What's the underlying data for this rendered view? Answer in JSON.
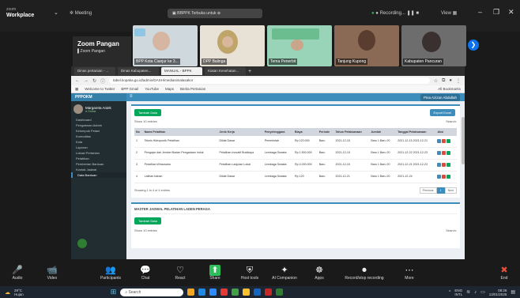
{
  "zoom": {
    "logo_top": "zoom",
    "logo_main": "Workplace",
    "meeting_label": "Meeting",
    "shared_screen_label": "BBPPK Terbuka untuk",
    "recording_label": "Recording...",
    "view_label": "View",
    "self_name": "Zoom Pangan",
    "self_sub": "Zoom Pangan"
  },
  "participants": [
    {
      "name": "BPP Kota Cianjur ke 3..."
    },
    {
      "name": "DPP Balinga"
    },
    {
      "name": "Tema Penerbit"
    },
    {
      "name": "Tanjung Kupong"
    },
    {
      "name": "Kabupaten Pancuran"
    }
  ],
  "browser": {
    "tabs": [
      "Dinas pertanian - ...",
      "Dinas Kabupaten...",
      "MANUAL - BPPK",
      "Kiatan Kesehatan..."
    ],
    "url": "tabel.kopaka.go.id/admin/DASH/mediasimalasakor",
    "bookmarks": [
      "Welcome to Twitter",
      "BPP Gmail",
      "YouTube",
      "Maps",
      "Berita Pertanian"
    ],
    "reading_list": "All Bookmarks"
  },
  "app": {
    "brand": "PPPOKM",
    "user_top": "Pina Azizan Abdullah",
    "side_user_name": "Margareta Aniek",
    "side_user_status": "Online",
    "sidebar": [
      "Dashboard",
      "Pengaturan Admin",
      "Kelompok Petani",
      "Komoditas",
      "Kota",
      "Laporan",
      "Lokasi Pertanian",
      "Pelatihan",
      "Pemberian Bantuan",
      "Kontak Jadwal",
      "Data Bantuan"
    ],
    "add_button": "Tambah Data",
    "export_button": "Export Excel",
    "show_entries": "Show 10 entries",
    "search_label": "Search:",
    "columns": [
      "No",
      "Nama Pelatihan",
      "Jenis Kerja",
      "Penyelenggara",
      "Biaya",
      "Periode",
      "Tahun Pelaksanaan",
      "Jumlah",
      "Tanggal Pelaksanaan",
      "Aksi"
    ],
    "rows": [
      [
        "1",
        "Teknis Hidroponik Pelatihan",
        "Diklat Dasar",
        "Pemerintah",
        "Rp 120.000",
        "Baru",
        "2021-12-15",
        "Baru 1 Baru 20",
        "2021-12-15 2021-12-21"
      ],
      [
        "2",
        "Pengajar dari Jember Badan Pengadaan Induk",
        "Pelatihan Inovatif Budidaya",
        "Lembaga Swasta",
        "Rp 1.500.000",
        "Baru",
        "2021-12-15",
        "Baru 1 Baru 20",
        "2021-12-22 2021-12-23"
      ],
      [
        "3",
        "Pelatihan Wirausaha",
        "Pelatihan Lanjutan Lokal",
        "Lembaga Swasta",
        "Rp 4.000.000",
        "Baru",
        "2021-12-15",
        "Baru 1 Baru 20",
        "2021-12-21 2021-12-23"
      ],
      [
        "4",
        "Latihan bahan",
        "Diklat Dasar",
        "Lembaga Swasta",
        "Rp 120",
        "Baru",
        "2021-12-21",
        "Baru 1 Baru 20",
        "2021-12-24"
      ]
    ],
    "info": "Showing 1 to 4 of 4 entries",
    "pager": [
      "Previous",
      "1",
      "Next"
    ],
    "section2_title": "MASTER JADWAL PELATIHAN LADEN PERAGA",
    "add_button2": "Tambah Data",
    "show_entries2": "Show 10 entries",
    "search_label2": "Search:"
  },
  "controls": [
    {
      "label": "Audio",
      "icon": "microphone-icon",
      "glyph": "🎤"
    },
    {
      "label": "Video",
      "icon": "video-icon",
      "glyph": "📹"
    },
    {
      "label": "Participants",
      "icon": "participants-icon",
      "glyph": "👥"
    },
    {
      "label": "Chat",
      "icon": "chat-icon",
      "glyph": "💬"
    },
    {
      "label": "React",
      "icon": "react-icon",
      "glyph": "♡"
    },
    {
      "label": "Share",
      "icon": "share-icon",
      "glyph": "⬆"
    },
    {
      "label": "Host tools",
      "icon": "shield-icon",
      "glyph": "⛨"
    },
    {
      "label": "AI Companion",
      "icon": "sparkle-icon",
      "glyph": "✦"
    },
    {
      "label": "Apps",
      "icon": "apps-icon",
      "glyph": "☸"
    },
    {
      "label": "Record/stop recording",
      "icon": "record-icon",
      "glyph": "⏺"
    },
    {
      "label": "More",
      "icon": "more-icon",
      "glyph": "⋯"
    },
    {
      "label": "End",
      "icon": "end-call-icon",
      "glyph": "✖"
    }
  ],
  "taskbar": {
    "weather_temp": "29°C",
    "weather_desc": "Hujan",
    "search_placeholder": "Search",
    "lang": "ENG",
    "lang_sub": "INTL",
    "time": "08:26",
    "date": "13/01/2025"
  },
  "colors": {
    "accent": "#3c8dbc",
    "green": "#00a65a",
    "red": "#dd4b39",
    "zoom_green": "#2dbd5a"
  }
}
